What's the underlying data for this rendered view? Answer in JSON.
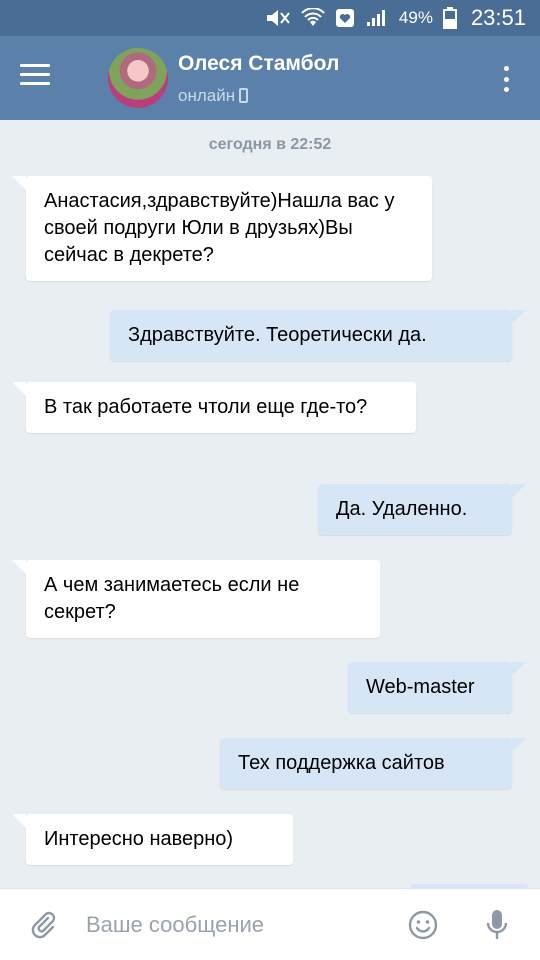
{
  "status_bar": {
    "battery": "49%",
    "time": "23:51"
  },
  "header": {
    "contact_name": "Олеся Стамбол",
    "status": "онлайн"
  },
  "chat": {
    "date_separator": "сегодня в 22:52",
    "messages": [
      {
        "direction": "in",
        "text": "Анастасия,здравствуйте)Нашла вас у своей подруги Юли в друзьях)Вы сейчас в декрете?"
      },
      {
        "direction": "out",
        "text": "Здравствуйте. Теоретически да."
      },
      {
        "direction": "in",
        "text": "В так работаете чтоли еще где-то?"
      },
      {
        "direction": "out",
        "text": "Да. Удаленно."
      },
      {
        "direction": "in",
        "text": "А чем занимаетесь если не секрет?"
      },
      {
        "direction": "out",
        "text": "Web-master"
      },
      {
        "direction": "out",
        "text": "Тех поддержка сайтов"
      },
      {
        "direction": "in",
        "text": "Интересно наверно)"
      }
    ]
  },
  "composer": {
    "placeholder": "Ваше сообщение"
  },
  "colors": {
    "status_bar": "#4a6d96",
    "header": "#5b81ab",
    "background": "#e9eef3",
    "incoming_bubble": "#ffffff",
    "outgoing_bubble": "#d6e6f7"
  }
}
